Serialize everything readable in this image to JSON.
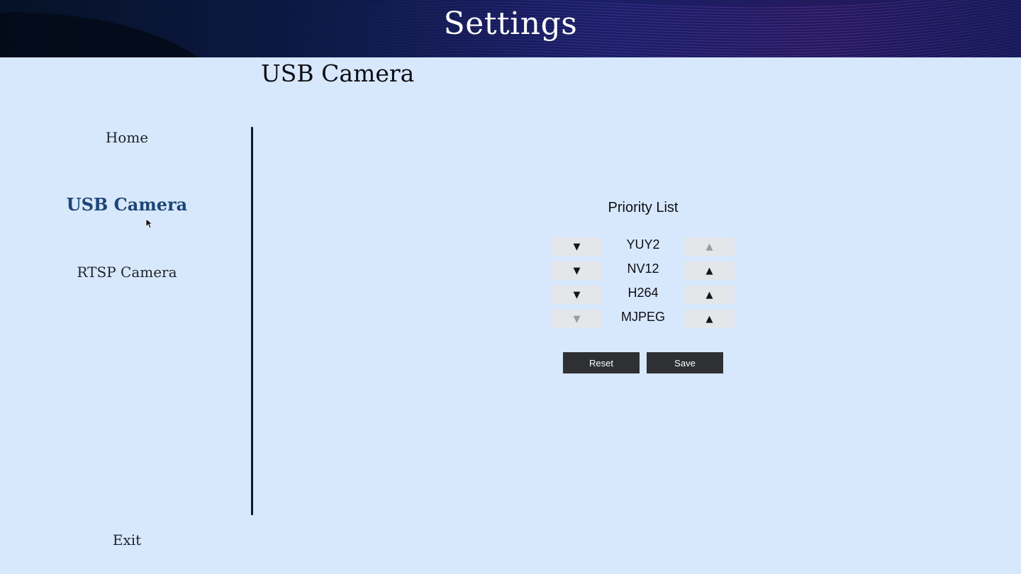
{
  "header": {
    "title": "Settings"
  },
  "page": {
    "title": "USB Camera"
  },
  "sidebar": {
    "items": [
      {
        "label": "Home",
        "active": false
      },
      {
        "label": "USB Camera",
        "active": true
      },
      {
        "label": "RTSP Camera",
        "active": false
      }
    ],
    "exit_label": "Exit"
  },
  "priority": {
    "title": "Priority List",
    "down_arrow": "▼",
    "up_arrow": "▲",
    "rows": [
      {
        "format": "YUY2",
        "down_enabled": true,
        "up_enabled": false
      },
      {
        "format": "NV12",
        "down_enabled": true,
        "up_enabled": true
      },
      {
        "format": "H264",
        "down_enabled": true,
        "up_enabled": true
      },
      {
        "format": "MJPEG",
        "down_enabled": false,
        "up_enabled": true
      }
    ]
  },
  "actions": {
    "reset_label": "Reset",
    "save_label": "Save"
  },
  "colors": {
    "background": "#d7e8fc",
    "active_nav": "#1d4577",
    "button_dark": "#2e3033",
    "arrow_button": "#e4e6ea"
  }
}
